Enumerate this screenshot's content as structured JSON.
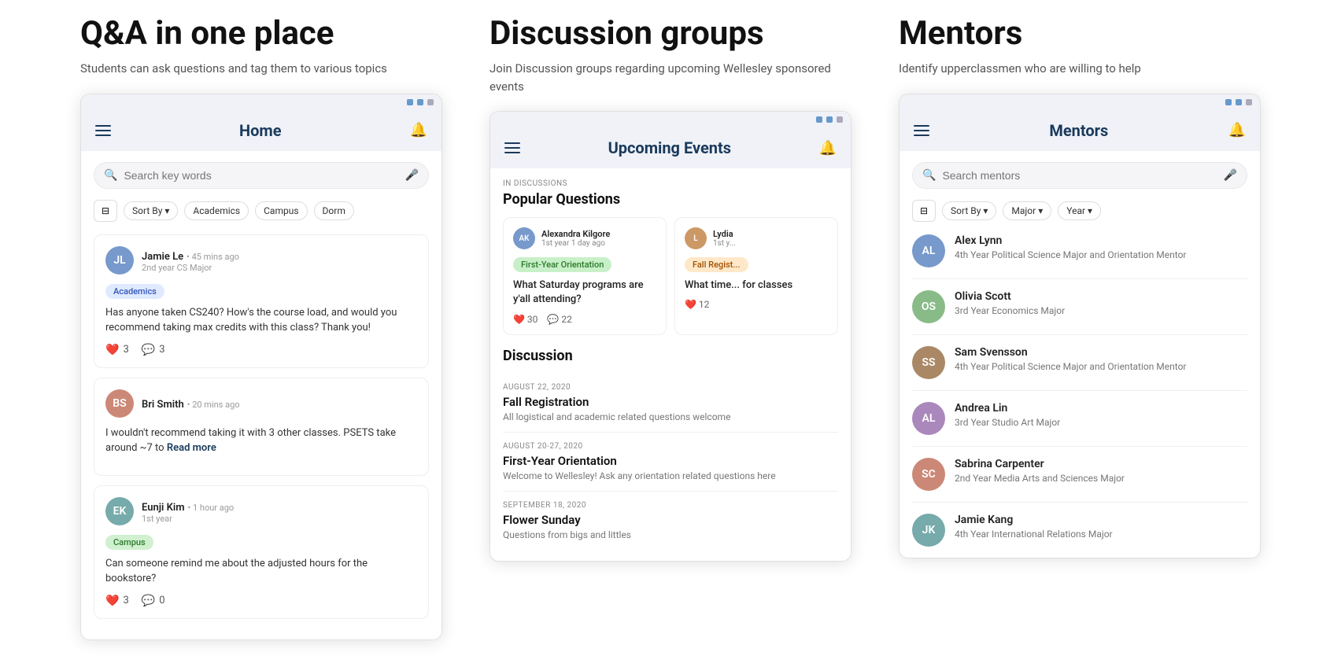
{
  "sections": [
    {
      "id": "qa",
      "title": "Q&A in one place",
      "subtitle": "Students can ask questions and tag them to various topics",
      "header_title": "Home",
      "search_placeholder": "Search key words",
      "filters": [
        "Sort By",
        "Academics",
        "Campus",
        "Dorm"
      ],
      "posts": [
        {
          "author": "Jamie Le",
          "time": "45 mins ago",
          "year": "2nd year CS Major",
          "tag": "Academics",
          "tag_class": "tag-academics",
          "text": "Has anyone taken CS240? How's the course load, and would you recommend taking max credits with this class? Thank you!",
          "hearts": 3,
          "comments": 3,
          "show_read_more": false
        },
        {
          "author": "Bri Smith",
          "time": "20 mins ago",
          "year": "",
          "tag": "",
          "tag_class": "",
          "text": "I wouldn't recommend taking it with 3 other classes. PSETS take around ~7 to",
          "hearts": null,
          "comments": null,
          "show_read_more": true
        },
        {
          "author": "Eunji Kim",
          "time": "1 hour ago",
          "year": "1st year",
          "tag": "Campus",
          "tag_class": "tag-campus",
          "text": "Can someone remind me about the adjusted hours for the bookstore?",
          "hearts": 3,
          "comments": 0,
          "show_read_more": false
        }
      ]
    },
    {
      "id": "discussion",
      "title": "Discussion groups",
      "subtitle": "Join Discussion groups regarding upcoming Wellesley sponsored events",
      "header_title": "Upcoming Events",
      "search_placeholder": "",
      "popular_label": "IN DISCUSSIONS",
      "popular_title": "Popular Questions",
      "question_cards": [
        {
          "author": "Alexandra Kilgore",
          "year": "1st year",
          "time": "1 day ago",
          "tag": "First-Year Orientation",
          "tag_class": "tag-first-year",
          "text": "What Saturday programs are y'all attending?",
          "hearts": 30,
          "comments": 22
        },
        {
          "author": "Lydia",
          "year": "1st y...",
          "time": "",
          "tag": "Fall Regist...",
          "tag_class": "tag-fall",
          "text": "What time... for classes",
          "hearts": 12,
          "comments": null
        }
      ],
      "discussion_section_title": "Discussion",
      "discussions": [
        {
          "date": "AUGUST 22, 2020",
          "name": "Fall Registration",
          "desc": "All logistical and academic related questions welcome"
        },
        {
          "date": "AUGUST 20-27, 2020",
          "name": "First-Year Orientation",
          "desc": "Welcome to Wellesley! Ask any orientation related questions here"
        },
        {
          "date": "SEPTEMBER 18, 2020",
          "name": "Flower Sunday",
          "desc": "Questions from bigs and littles"
        }
      ]
    },
    {
      "id": "mentors",
      "title": "Mentors",
      "subtitle": "Identify upperclassmen who are willing to help",
      "header_title": "Mentors",
      "search_placeholder": "Search mentors",
      "filters_mentors": [
        "Sort By",
        "Major",
        "Year"
      ],
      "mentors": [
        {
          "name": "Alex Lynn",
          "detail": "4th Year Political Science Major and Orientation Mentor",
          "av_class": "av-blue"
        },
        {
          "name": "Olivia Scott",
          "detail": "3rd Year Economics Major",
          "av_class": "av-green"
        },
        {
          "name": "Sam Svensson",
          "detail": "4th Year Political Science Major and Orientation Mentor",
          "av_class": "av-brown"
        },
        {
          "name": "Andrea Lin",
          "detail": "3rd Year Studio Art Major",
          "av_class": "av-purple"
        },
        {
          "name": "Sabrina Carpenter",
          "detail": "2nd Year Media Arts and Sciences Major",
          "av_class": "av-coral"
        },
        {
          "name": "Jamie Kang",
          "detail": "4th Year International Relations Major",
          "av_class": "av-teal"
        }
      ]
    }
  ],
  "icons": {
    "hamburger": "☰",
    "bell": "🔔",
    "search": "🔍",
    "mic": "🎤",
    "heart": "❤️",
    "comment": "💬",
    "filter": "⊟",
    "chevron_down": "▾"
  }
}
